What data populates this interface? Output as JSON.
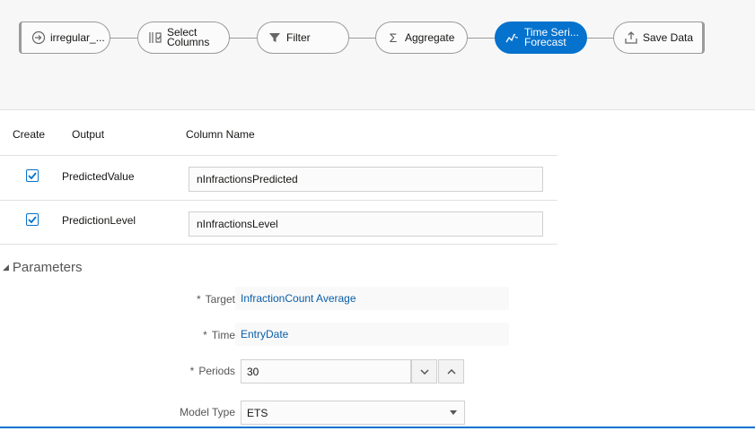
{
  "pipeline": {
    "nodes": [
      {
        "label": "irregular_...",
        "icon": "dataset-source-icon"
      },
      {
        "label": "Select Columns",
        "line1": "Select",
        "line2": "Columns",
        "icon": "select-columns-icon"
      },
      {
        "label": "Filter",
        "icon": "filter-icon"
      },
      {
        "label": "Aggregate",
        "icon": "sigma-icon"
      },
      {
        "label": "Time Series Forecast",
        "line1": "Time Seri...",
        "line2": "Forecast",
        "icon": "forecast-icon"
      },
      {
        "label": "Save Data",
        "icon": "save-data-icon"
      }
    ],
    "active_index": 4,
    "active_color": "#0572ce"
  },
  "outputs": {
    "headers": {
      "create": "Create",
      "output": "Output",
      "column_name": "Column Name"
    },
    "rows": [
      {
        "checked": true,
        "output": "PredictedValue",
        "column_name": "nInfractionsPredicted"
      },
      {
        "checked": true,
        "output": "PredictionLevel",
        "column_name": "nInfractionsLevel"
      }
    ]
  },
  "parameters": {
    "title": "Parameters",
    "target": {
      "label": "Target",
      "value": "InfractionCount Average",
      "required": "*"
    },
    "time": {
      "label": "Time",
      "value": "EntryDate",
      "required": "*"
    },
    "periods": {
      "label": "Periods",
      "value": "30",
      "required": "*"
    },
    "model_type": {
      "label": "Model Type",
      "value": "ETS"
    }
  }
}
